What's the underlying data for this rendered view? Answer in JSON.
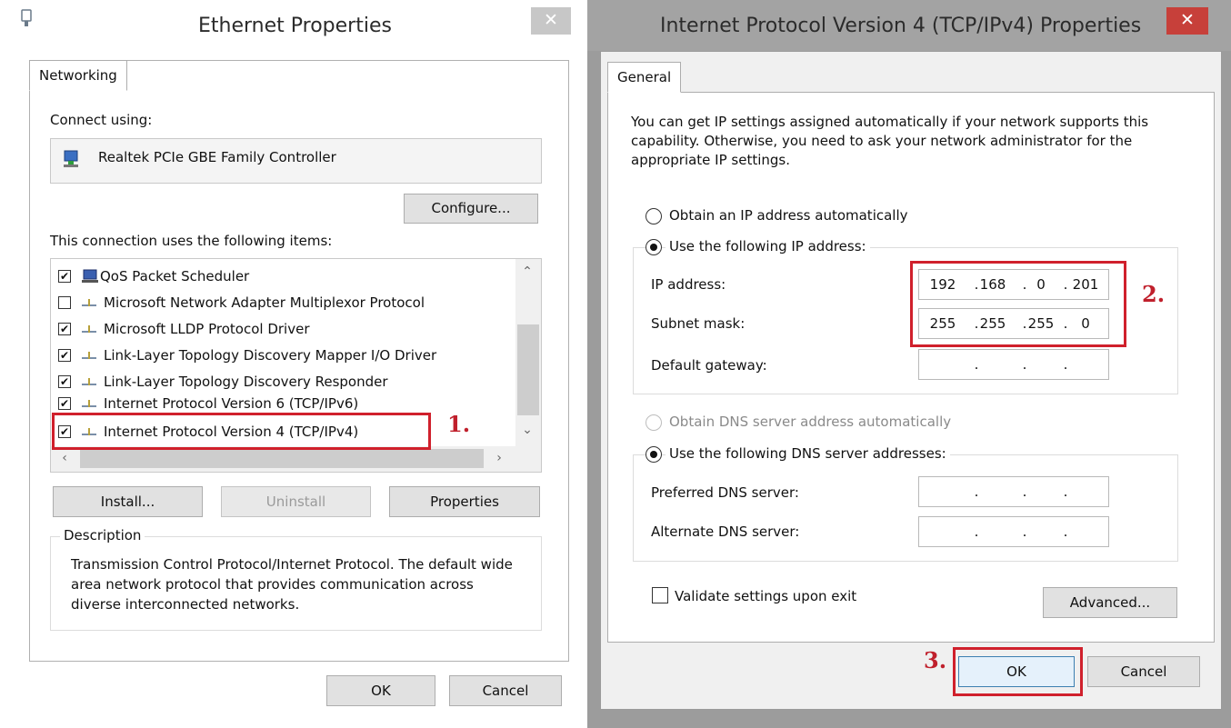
{
  "left": {
    "title": "Ethernet Properties",
    "close": "✕",
    "tab": "Networking",
    "connect_using": "Connect using:",
    "adapter": "Realtek PCIe GBE Family Controller",
    "configure": "Configure...",
    "items_label": "This connection uses the following items:",
    "items": [
      {
        "label": "QoS Packet Scheduler",
        "checked": "✔"
      },
      {
        "label": "Microsoft Network Adapter Multiplexor Protocol",
        "checked": ""
      },
      {
        "label": "Microsoft LLDP Protocol Driver",
        "checked": "✔"
      },
      {
        "label": "Link-Layer Topology Discovery Mapper I/O Driver",
        "checked": "✔"
      },
      {
        "label": "Link-Layer Topology Discovery Responder",
        "checked": "✔"
      },
      {
        "label": "Internet Protocol Version 6 (TCP/IPv6)",
        "checked": "✔"
      },
      {
        "label": "Internet Protocol Version 4 (TCP/IPv4)",
        "checked": "✔"
      }
    ],
    "install": "Install...",
    "uninstall": "Uninstall",
    "properties": "Properties",
    "description_title": "Description",
    "description": "Transmission Control Protocol/Internet Protocol. The default wide area network protocol that provides communication across diverse interconnected networks.",
    "ok": "OK",
    "cancel": "Cancel",
    "annotation": "1."
  },
  "right": {
    "title": "Internet Protocol Version 4 (TCP/IPv4) Properties",
    "close": "✕",
    "tab": "General",
    "intro": "You can get IP settings assigned automatically if your network supports this capability. Otherwise, you need to ask your network administrator for the appropriate IP settings.",
    "obtain_ip": "Obtain an IP address automatically",
    "use_ip": "Use the following IP address:",
    "ip_label": "IP address:",
    "ip_value": [
      "192",
      "168",
      "0",
      "201"
    ],
    "mask_label": "Subnet mask:",
    "mask_value": [
      "255",
      "255",
      "255",
      "0"
    ],
    "gateway_label": "Default gateway:",
    "obtain_dns": "Obtain DNS server address automatically",
    "use_dns": "Use the following DNS server addresses:",
    "pref_dns": "Preferred DNS server:",
    "alt_dns": "Alternate DNS server:",
    "validate": "Validate settings upon exit",
    "advanced": "Advanced...",
    "ok": "OK",
    "cancel": "Cancel",
    "annotation2": "2.",
    "annotation3": "3."
  },
  "colors": {
    "close_left": "#c7c7c7",
    "close_right": "#c7403a",
    "annotation": "#d0202c"
  }
}
